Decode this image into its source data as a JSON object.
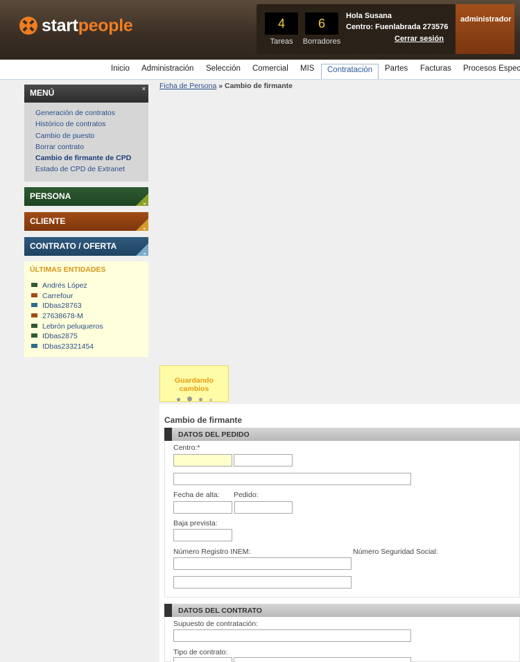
{
  "brand": {
    "part1": "start",
    "part2": "people"
  },
  "user": {
    "tareas_count": "4",
    "tareas_label": "Tareas",
    "borradores_count": "6",
    "borradores_label": "Borradores",
    "greeting": "Hola Susana",
    "centro": "Centro: Fuenlabrada 273576",
    "logout": "Cerrar sesión",
    "role": "administrador"
  },
  "nav": {
    "items": [
      "Inicio",
      "Administración",
      "Selección",
      "Comercial",
      "MIS",
      "Contratación",
      "Partes",
      "Facturas",
      "Procesos Espec"
    ]
  },
  "sidebar": {
    "menu_title": "MENÚ",
    "close": "×",
    "links": [
      "Generación de contratos",
      "Histórico de contratos",
      "Cambio de puesto",
      "Borrar contrato",
      "Cambio de firmante de CPD",
      "Estado de CPD de Extranet"
    ],
    "sections": [
      "PERSONA",
      "CLIENTE",
      "CONTRATO / OFERTA"
    ],
    "ultimas_title": "ÚLTIMAS ENTIDADES",
    "entities": [
      {
        "label": "Andrés López",
        "color": "#2e5a32"
      },
      {
        "label": "Carrefour",
        "color": "#a04c16"
      },
      {
        "label": "IDbas28763",
        "color": "#2f6a8e"
      },
      {
        "label": "27638678-M",
        "color": "#a04c16"
      },
      {
        "label": "Lebrón peluqueros",
        "color": "#2e5a32"
      },
      {
        "label": "IDbas2875",
        "color": "#2e5a32"
      },
      {
        "label": "IDbas23321454",
        "color": "#2f6a8e"
      }
    ]
  },
  "breadcrumb": {
    "link": "Ficha de Persona",
    "separator": " » ",
    "current": "Cambio de firmante"
  },
  "saving": {
    "text": "Guardando cambios"
  },
  "form": {
    "title": "Cambio de firmante",
    "section1": "DATOS DEL PEDIDO",
    "section2": "DATOS DEL CONTRATO",
    "labels": {
      "centro": "Centro:*",
      "fecha_alta": "Fecha de alta:",
      "pedido": "Pedido:",
      "baja_prevista": "Baja prevista:",
      "inem": "Número Registro INEM:",
      "nss": "Número Seguridad Social:",
      "supuesto": "Supuesto de contratación:",
      "tipo": "Tipo de contrato:"
    }
  }
}
